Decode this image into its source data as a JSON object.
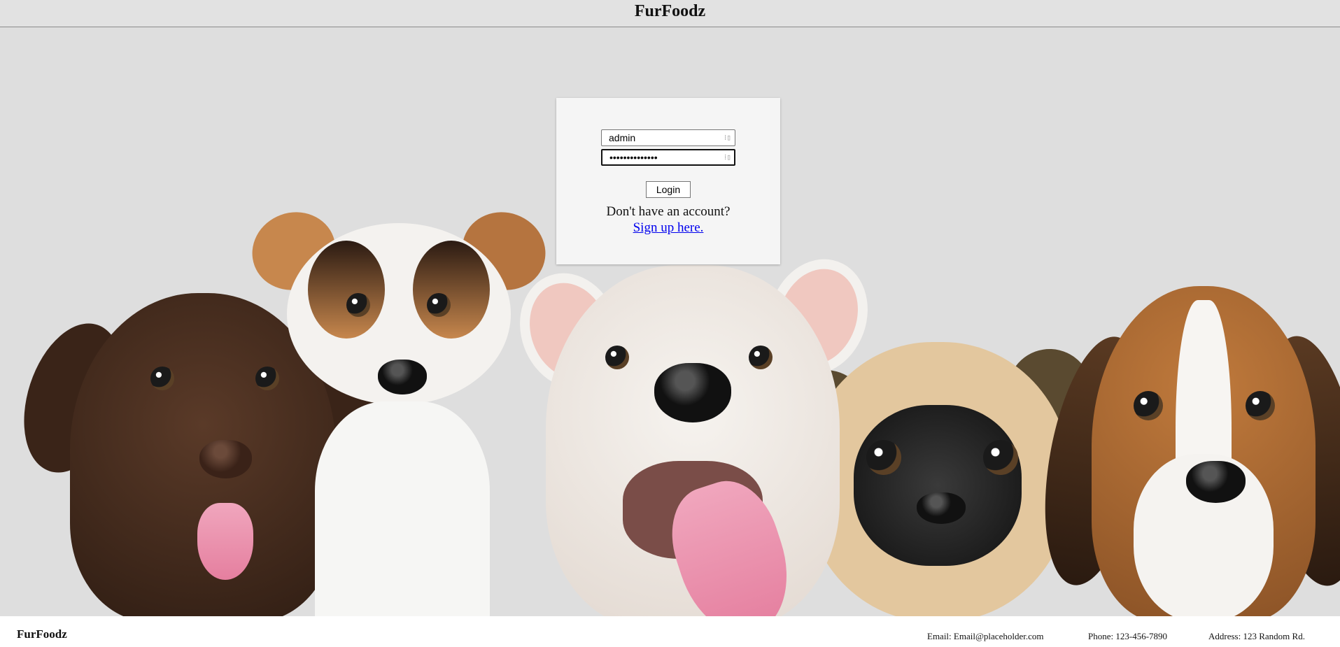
{
  "header": {
    "title": "FurFoodz"
  },
  "login": {
    "username_value": "admin",
    "password_value": "••••••••••••••",
    "login_label": "Login",
    "no_account_text": "Don't have an account?",
    "signup_link": "Sign up here."
  },
  "footer": {
    "brand": "FurFoodz",
    "email": "Email: Email@placeholder.com",
    "phone": "Phone: 123-456-7890",
    "address": "Address: 123 Random Rd."
  },
  "icons": {
    "field_icon": "password-manager-icon"
  }
}
